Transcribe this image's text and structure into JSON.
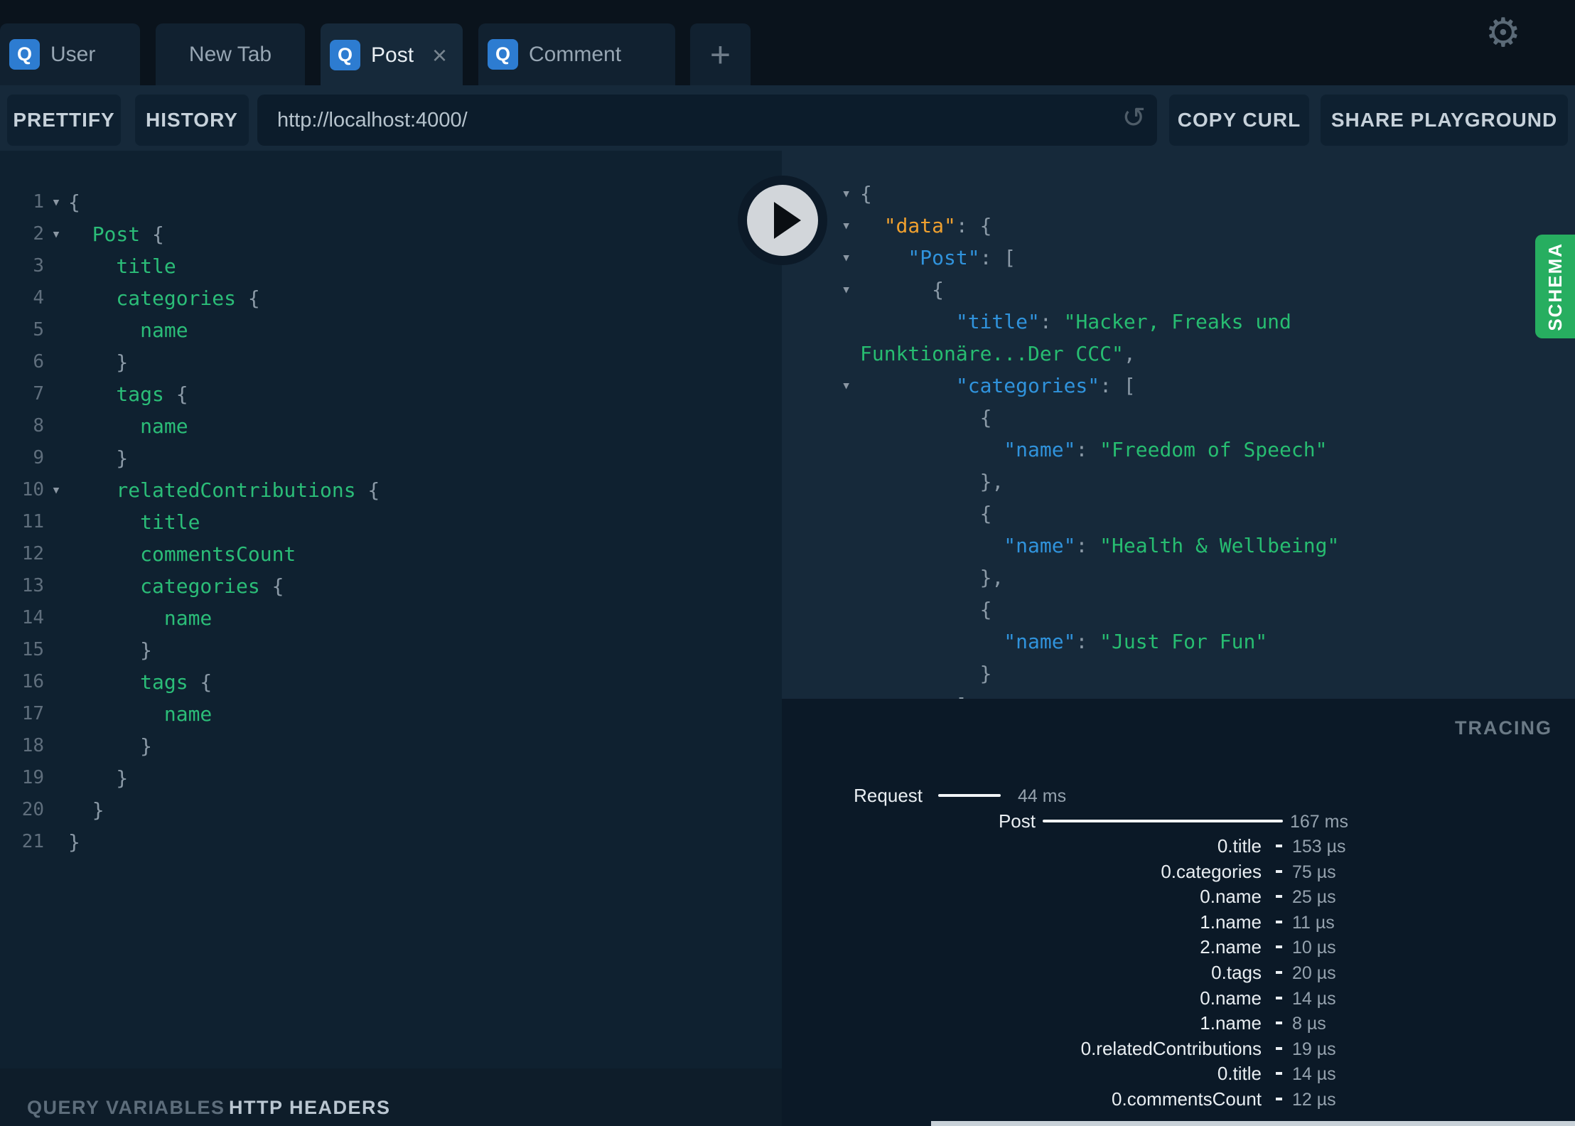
{
  "tabs": [
    {
      "badge": "Q",
      "label": "User"
    },
    {
      "label": "New Tab"
    },
    {
      "badge": "Q",
      "label": "Post",
      "close": "×"
    },
    {
      "badge": "Q",
      "label": "Comment"
    }
  ],
  "new_tab_button": "+",
  "icons": {
    "gear": "⚙",
    "reload": "↺"
  },
  "toolbar": {
    "prettify": "PRETTIFY",
    "history": "HISTORY",
    "url": "http://localhost:4000/",
    "copy_curl": "COPY CURL",
    "share": "SHARE PLAYGROUND"
  },
  "editor": {
    "lines": [
      {
        "num": "1",
        "fold": "▾",
        "punct": "{"
      },
      {
        "num": "2",
        "fold": "▾",
        "field": "Post",
        "punct": " {"
      },
      {
        "num": "3",
        "field": "title"
      },
      {
        "num": "4",
        "field": "categories",
        "punct": " {"
      },
      {
        "num": "5",
        "field": "name"
      },
      {
        "num": "6",
        "punct": "}"
      },
      {
        "num": "7",
        "field": "tags",
        "punct": " {"
      },
      {
        "num": "8",
        "field": "name"
      },
      {
        "num": "9",
        "punct": "}"
      },
      {
        "num": "10",
        "fold": "▾",
        "field": "relatedContributions",
        "punct": " {"
      },
      {
        "num": "11",
        "field": "title"
      },
      {
        "num": "12",
        "field": "commentsCount"
      },
      {
        "num": "13",
        "field": "categories",
        "punct": " {"
      },
      {
        "num": "14",
        "field": "name"
      },
      {
        "num": "15",
        "punct": "}"
      },
      {
        "num": "16",
        "field": "tags",
        "punct": " {"
      },
      {
        "num": "17",
        "field": "name"
      },
      {
        "num": "18",
        "punct": "}"
      },
      {
        "num": "19",
        "punct": "}"
      },
      {
        "num": "20",
        "punct": "}"
      },
      {
        "num": "21",
        "punct": "}"
      }
    ]
  },
  "response": {
    "lines": [
      {
        "fold": "▾",
        "punct": "{"
      },
      {
        "fold": "▾",
        "key": "\"data\"",
        "sep": ": ",
        "punct": "{"
      },
      {
        "fold": "▾",
        "key": "\"Post\"",
        "sep": ": ",
        "punct": "["
      },
      {
        "fold": "▾",
        "punct": "{"
      },
      {
        "key": "\"title\"",
        "sep": ": ",
        "val": "\"Hacker, Freaks und"
      },
      {
        "val": "Funktionäre...Der CCC\"",
        "punct": ","
      },
      {
        "fold": "▾",
        "key": "\"categories\"",
        "sep": ": ",
        "punct": "["
      },
      {
        "punct": "{"
      },
      {
        "key": "\"name\"",
        "sep": ": ",
        "val": "\"Freedom of Speech\""
      },
      {
        "punct": "},"
      },
      {
        "punct": "{"
      },
      {
        "key": "\"name\"",
        "sep": ": ",
        "val": "\"Health & Wellbeing\""
      },
      {
        "punct": "},"
      },
      {
        "punct": "{"
      },
      {
        "key": "\"name\"",
        "sep": ": ",
        "val": "\"Just For Fun\""
      },
      {
        "punct": "}"
      },
      {
        "punct": "]"
      }
    ]
  },
  "schema_tab": "SCHEMA",
  "tracing": {
    "title": "TRACING",
    "rows": [
      {
        "label": "Request",
        "time": "44 ms",
        "type": "bar"
      },
      {
        "label": "Post",
        "time": "167 ms",
        "type": "bar"
      },
      {
        "label": "0.title",
        "time": "153 µs"
      },
      {
        "label": "0.categories",
        "time": "75 µs"
      },
      {
        "label": "0.name",
        "time": "25 µs"
      },
      {
        "label": "1.name",
        "time": "11 µs"
      },
      {
        "label": "2.name",
        "time": "10 µs"
      },
      {
        "label": "0.tags",
        "time": "20 µs"
      },
      {
        "label": "0.name",
        "time": "14 µs"
      },
      {
        "label": "1.name",
        "time": "8 µs"
      },
      {
        "label": "0.relatedContributions",
        "time": "19 µs"
      },
      {
        "label": "0.title",
        "time": "14 µs"
      },
      {
        "label": "0.commentsCount",
        "time": "12 µs"
      }
    ]
  },
  "footer": {
    "query_variables": "QUERY VARIABLES",
    "http_headers": "HTTP HEADERS"
  },
  "colors": {
    "accent_green": "#27ae60",
    "badge_blue": "#2d7cd1",
    "field_green": "#2bbd78",
    "key_blue": "#3093dc",
    "key_orange": "#efa02f",
    "string_green": "#27bd71"
  }
}
